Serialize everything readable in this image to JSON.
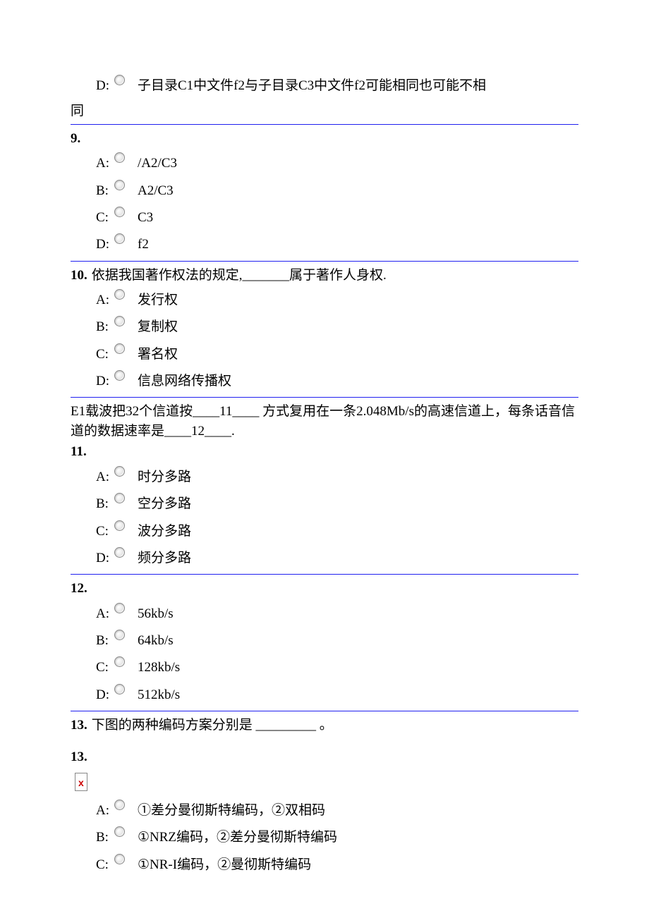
{
  "q8_trail": {
    "letter": "D:",
    "text": "子目录C1中文件f2与子目录C3中文件f2可能相同也可能不相",
    "wrap": "同"
  },
  "q9": {
    "num": "9.",
    "options": [
      {
        "letter": "A:",
        "text": "/A2/C3"
      },
      {
        "letter": "B:",
        "text": "A2/C3"
      },
      {
        "letter": "C:",
        "text": "C3"
      },
      {
        "letter": "D:",
        "text": "f2"
      }
    ]
  },
  "q10": {
    "num": "10.",
    "stem": "依据我国著作权法的规定,_______属于著作人身权.",
    "options": [
      {
        "letter": "A:",
        "text": "发行权"
      },
      {
        "letter": "B:",
        "text": "复制权"
      },
      {
        "letter": "C:",
        "text": "署名权"
      },
      {
        "letter": "D:",
        "text": "信息网络传播权"
      }
    ]
  },
  "passage_11_12": "E1载波把32个信道按____11____ 方式复用在一条2.048Mb/s的高速信道上，每条话音信道的数据速率是____12____.",
  "q11": {
    "num": "11.",
    "options": [
      {
        "letter": "A:",
        "text": "时分多路"
      },
      {
        "letter": "B:",
        "text": "空分多路"
      },
      {
        "letter": "C:",
        "text": "波分多路"
      },
      {
        "letter": "D:",
        "text": "频分多路"
      }
    ]
  },
  "q12": {
    "num": "12.",
    "options": [
      {
        "letter": "A:",
        "text": "56kb/s"
      },
      {
        "letter": "B:",
        "text": "64kb/s"
      },
      {
        "letter": "C:",
        "text": "128kb/s"
      },
      {
        "letter": "D:",
        "text": "512kb/s"
      }
    ]
  },
  "q13": {
    "num": "13.",
    "stem": "下图的两种编码方案分别是 _________ 。",
    "num2": "13.",
    "img_alt": "x",
    "options": [
      {
        "letter": "A:",
        "text": "①差分曼彻斯特编码，②双相码"
      },
      {
        "letter": "B:",
        "text": "①NRZ编码，②差分曼彻斯特编码"
      },
      {
        "letter": "C:",
        "text": "①NR-I编码，②曼彻斯特编码"
      }
    ]
  }
}
